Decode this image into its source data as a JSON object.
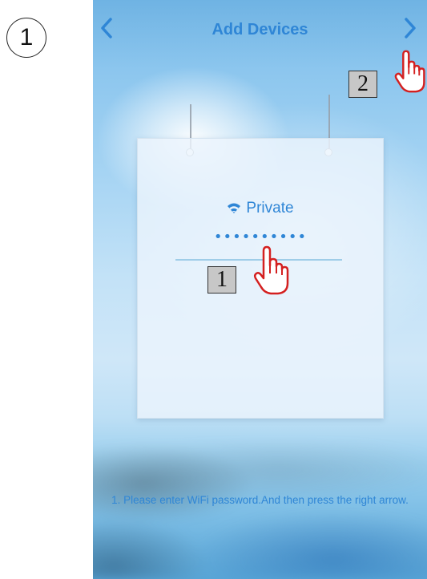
{
  "step_number": "1",
  "header": {
    "title": "Add Devices"
  },
  "wifi": {
    "ssid": "Private",
    "password_masked": "••••••••••"
  },
  "markers": {
    "password_marker": "1",
    "next_marker": "2"
  },
  "instruction": "1. Please enter WiFi password.And then press the right arrow.",
  "colors": {
    "accent": "#2f86d6",
    "hand_outline": "#d42020",
    "marker_bg": "#c7c7c7"
  },
  "icons": {
    "back": "chevron-left-icon",
    "next": "chevron-right-icon",
    "wifi": "wifi-icon",
    "pointer": "pointing-hand-icon"
  }
}
